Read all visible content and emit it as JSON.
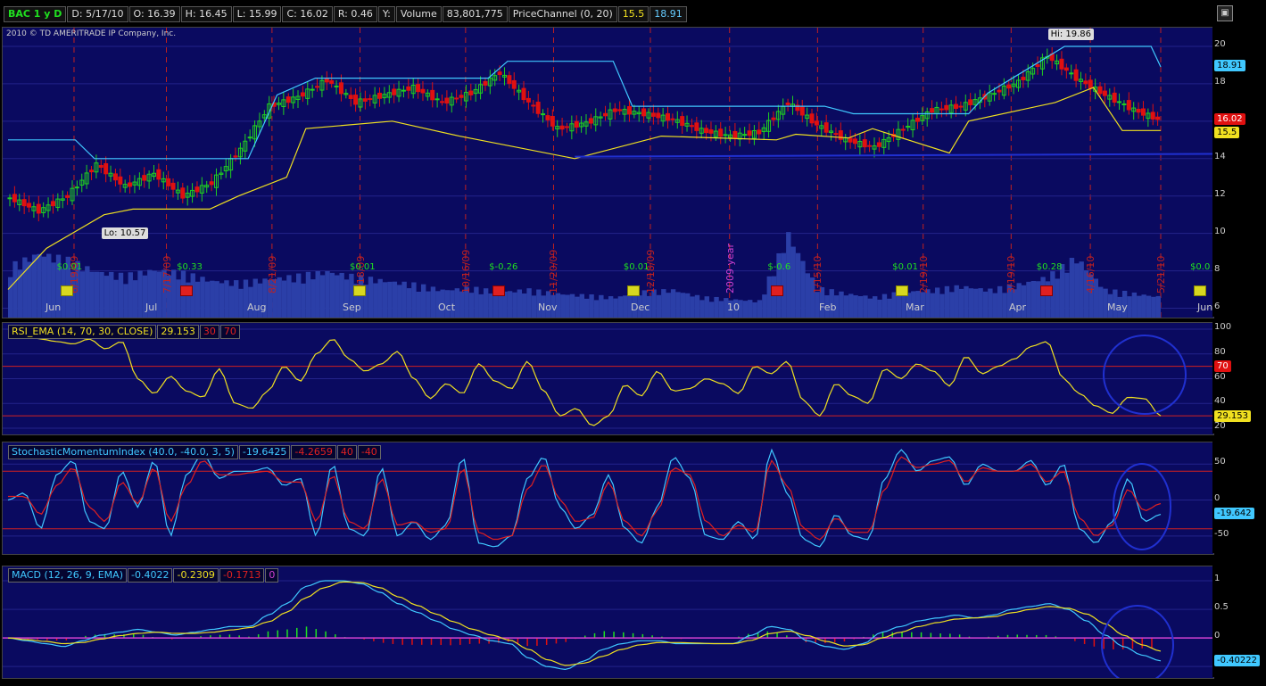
{
  "header": {
    "symbol": "BAC 1 y D",
    "date": "D: 5/17/10",
    "open": "O: 16.39",
    "high": "H: 16.45",
    "low": "L: 15.99",
    "close": "C: 16.02",
    "range": "R: 0.46",
    "y": "Y:",
    "volume_label": "Volume",
    "volume_value": "83,801,775",
    "study_label": "PriceChannel (0, 20)",
    "study_low": "15.5",
    "study_high": "18.91",
    "copyright": "2010 © TD AMERITRADE IP Company, Inc."
  },
  "colors": {
    "pane_bg": "#0a0a60",
    "up_candle": "#20d020",
    "down_candle": "#e01010",
    "channel_upper": "#40c8ff",
    "channel_lower": "#f0e020",
    "rsi_line": "#f0e020",
    "smi_line": "#40c8ff",
    "smi_signal": "#e02020",
    "macd_line": "#40c8ff",
    "macd_signal": "#f0e020",
    "hist_pos": "#20e020",
    "hist_neg": "#e01010",
    "annotation": "#2030d0"
  },
  "chart_data": [
    {
      "type": "candlestick",
      "title": "BAC 1 y D",
      "x_months": [
        "Jun",
        "Jul",
        "Aug",
        "Sep",
        "Oct",
        "Nov",
        "Dec",
        "10",
        "Feb",
        "Mar",
        "Apr",
        "May",
        "Jun"
      ],
      "ylim": [
        5.5,
        21
      ],
      "yticks": [
        6,
        8,
        10,
        12,
        14,
        16,
        18,
        20
      ],
      "grid": true,
      "close_points": [
        [
          0,
          11.9
        ],
        [
          6,
          11.2
        ],
        [
          12,
          12.0
        ],
        [
          18,
          13.7
        ],
        [
          24,
          12.5
        ],
        [
          30,
          13.2
        ],
        [
          36,
          12.0
        ],
        [
          42,
          12.7
        ],
        [
          48,
          14.5
        ],
        [
          54,
          16.8
        ],
        [
          60,
          17.3
        ],
        [
          66,
          18.2
        ],
        [
          72,
          17.0
        ],
        [
          78,
          17.4
        ],
        [
          84,
          17.8
        ],
        [
          90,
          17.0
        ],
        [
          96,
          17.5
        ],
        [
          102,
          18.6
        ],
        [
          108,
          17.0
        ],
        [
          114,
          15.6
        ],
        [
          120,
          15.9
        ],
        [
          126,
          16.6
        ],
        [
          132,
          16.4
        ],
        [
          138,
          16.1
        ],
        [
          144,
          15.5
        ],
        [
          150,
          15.2
        ],
        [
          156,
          15.4
        ],
        [
          162,
          17.0
        ],
        [
          168,
          15.8
        ],
        [
          174,
          15.0
        ],
        [
          180,
          14.6
        ],
        [
          186,
          15.6
        ],
        [
          192,
          16.6
        ],
        [
          198,
          16.8
        ],
        [
          204,
          17.4
        ],
        [
          210,
          18.1
        ],
        [
          216,
          19.5
        ],
        [
          222,
          18.3
        ],
        [
          228,
          17.4
        ],
        [
          234,
          16.6
        ],
        [
          240,
          16.0
        ]
      ],
      "hi_label": "Hi: 19.86",
      "lo_label": "Lo: 10.57",
      "last_price_tag": "16.02",
      "price_channel": {
        "name": "PriceChannel (0, 20)",
        "upper": [
          [
            0,
            15.0
          ],
          [
            14,
            15.0
          ],
          [
            18,
            14.0
          ],
          [
            40,
            14.0
          ],
          [
            50,
            14.0
          ],
          [
            56,
            17.4
          ],
          [
            64,
            18.3
          ],
          [
            100,
            18.3
          ],
          [
            104,
            19.2
          ],
          [
            126,
            19.2
          ],
          [
            130,
            16.8
          ],
          [
            170,
            16.8
          ],
          [
            176,
            16.4
          ],
          [
            200,
            16.4
          ],
          [
            204,
            17.5
          ],
          [
            220,
            20.0
          ],
          [
            238,
            20.0
          ],
          [
            240,
            18.9
          ]
        ],
        "lower": [
          [
            0,
            7.0
          ],
          [
            8,
            9.2
          ],
          [
            20,
            11.0
          ],
          [
            26,
            11.3
          ],
          [
            42,
            11.3
          ],
          [
            48,
            12.0
          ],
          [
            58,
            13.0
          ],
          [
            62,
            15.6
          ],
          [
            80,
            16.0
          ],
          [
            94,
            15.2
          ],
          [
            118,
            14.0
          ],
          [
            136,
            15.2
          ],
          [
            160,
            15.0
          ],
          [
            164,
            15.3
          ],
          [
            175,
            15.1
          ],
          [
            180,
            15.6
          ],
          [
            196,
            14.3
          ],
          [
            200,
            16.0
          ],
          [
            218,
            17.0
          ],
          [
            226,
            17.8
          ],
          [
            232,
            15.5
          ],
          [
            240,
            15.5
          ]
        ],
        "upper_tag": "18.91",
        "lower_tag": "15.5"
      },
      "volume_bars_norm": [
        0.55,
        0.7,
        0.62,
        0.5,
        0.45,
        0.52,
        0.48,
        0.4,
        0.38,
        0.42,
        0.45,
        0.5,
        0.44,
        0.4,
        0.36,
        0.3,
        0.32,
        0.28,
        0.3,
        0.26,
        0.24,
        0.22,
        0.28,
        0.3,
        0.22,
        0.2,
        0.18,
        0.9,
        0.32,
        0.26,
        0.22,
        0.28,
        0.3,
        0.34,
        0.3,
        0.36,
        0.44,
        0.65,
        0.3,
        0.26,
        0.22
      ],
      "dates": [
        "6/19/09",
        "7/17/09",
        "8/21/09",
        "9/18/09",
        "10/16/09",
        "11/20/09",
        "12/18/09",
        "2009 year",
        "1/15/10",
        "2/19/10",
        "3/19/10",
        "4/16/10",
        "5/21/10"
      ],
      "events": [
        {
          "label": "$0.01",
          "x": 12,
          "icon": "dividend"
        },
        {
          "label": "$0.33",
          "x": 37,
          "icon": "earnings"
        },
        {
          "label": "$0.01",
          "x": 73,
          "icon": "dividend"
        },
        {
          "label": "$-0.26",
          "x": 102,
          "icon": "earnings"
        },
        {
          "label": "$0.01",
          "x": 130,
          "icon": "dividend"
        },
        {
          "label": "$-0.6",
          "x": 160,
          "icon": "earnings"
        },
        {
          "label": "$0.01",
          "x": 186,
          "icon": "dividend"
        },
        {
          "label": "$0.28",
          "x": 216,
          "icon": "earnings"
        },
        {
          "label": "$0.0",
          "x": 248,
          "icon": "dividend"
        }
      ]
    },
    {
      "type": "line",
      "title": "RSI_EMA (14, 70, 30, CLOSE)",
      "value_label": "29.153",
      "overbought_label": "70",
      "oversold_label": "30",
      "ylim": [
        15,
        105
      ],
      "yticks": [
        20,
        40,
        60,
        80,
        100
      ],
      "levels": [
        70,
        30
      ],
      "series": [
        {
          "name": "RSI",
          "values": [
            100,
            96,
            92,
            90,
            88,
            92,
            84,
            90,
            60,
            48,
            62,
            50,
            45,
            68,
            40,
            36,
            50,
            70,
            58,
            80,
            92,
            76,
            66,
            72,
            82,
            60,
            44,
            56,
            48,
            72,
            58,
            52,
            74,
            50,
            30,
            36,
            22,
            30,
            55,
            46,
            66,
            50,
            52,
            60,
            56,
            48,
            70,
            64,
            74,
            42,
            30,
            56,
            46,
            40,
            68,
            60,
            72,
            66,
            54,
            78,
            64,
            70,
            76,
            86,
            90,
            60,
            48,
            38,
            32,
            45,
            44,
            30
          ]
        }
      ]
    },
    {
      "type": "line",
      "title": "StochasticMomentumIndex (40.0, -40.0, 3, 5)",
      "value_label": "-19.6425",
      "avg_label": "-4.2659",
      "over_label": "40",
      "under_label": "-40",
      "ylim": [
        -75,
        80
      ],
      "yticks": [
        50,
        0,
        -50
      ],
      "levels": [
        40,
        -40
      ],
      "series": [
        {
          "name": "SMI",
          "values": [
            0,
            10,
            -40,
            35,
            55,
            -30,
            -40,
            40,
            -10,
            55,
            -50,
            35,
            65,
            30,
            40,
            40,
            45,
            20,
            30,
            -50,
            50,
            -40,
            -50,
            45,
            -50,
            -30,
            -55,
            -35,
            60,
            -60,
            -65,
            -50,
            30,
            60,
            -10,
            -40,
            -20,
            35,
            -40,
            -60,
            -10,
            60,
            30,
            -50,
            -55,
            -30,
            -55,
            70,
            10,
            -55,
            -65,
            -20,
            -50,
            -55,
            30,
            70,
            40,
            55,
            60,
            20,
            50,
            40,
            40,
            55,
            20,
            50,
            -40,
            -60,
            -30,
            30,
            -30,
            -20
          ]
        },
        {
          "name": "Avg",
          "values": [
            5,
            5,
            -20,
            20,
            45,
            -10,
            -30,
            25,
            -5,
            45,
            -30,
            20,
            55,
            35,
            35,
            38,
            40,
            25,
            25,
            -30,
            35,
            -30,
            -40,
            30,
            -35,
            -30,
            -45,
            -40,
            45,
            -45,
            -55,
            -50,
            15,
            50,
            0,
            -30,
            -25,
            25,
            -30,
            -50,
            -15,
            45,
            35,
            -30,
            -50,
            -35,
            -45,
            55,
            20,
            -40,
            -55,
            -25,
            -45,
            -45,
            15,
            60,
            45,
            50,
            55,
            25,
            45,
            40,
            40,
            50,
            25,
            40,
            -25,
            -50,
            -35,
            15,
            -15,
            -5
          ]
        }
      ],
      "value_tag": "-19.642"
    },
    {
      "type": "line",
      "title": "MACD (12, 26, 9, EMA)",
      "value_label": "-0.4022",
      "avg_label": "-0.2309",
      "diff_label": "-0.1713",
      "zero_label": "0",
      "ylim": [
        -0.7,
        1.25
      ],
      "yticks": [
        1,
        0.5,
        0,
        -0.5
      ],
      "levels": [
        0
      ],
      "series": [
        {
          "name": "MACD",
          "values": [
            0,
            -0.05,
            -0.1,
            -0.15,
            -0.05,
            0.05,
            0.1,
            0.15,
            0.1,
            0.05,
            0.1,
            0.15,
            0.2,
            0.2,
            0.4,
            0.6,
            0.9,
            1.0,
            1.0,
            0.95,
            0.8,
            0.6,
            0.45,
            0.3,
            0.15,
            0.05,
            -0.05,
            -0.1,
            -0.35,
            -0.5,
            -0.55,
            -0.4,
            -0.2,
            -0.1,
            -0.05,
            -0.05,
            -0.1,
            -0.1,
            -0.1,
            -0.1,
            0.05,
            0.2,
            0.15,
            -0.05,
            -0.15,
            -0.2,
            -0.1,
            0.1,
            0.2,
            0.3,
            0.35,
            0.4,
            0.35,
            0.4,
            0.5,
            0.55,
            0.6,
            0.5,
            0.3,
            0.05,
            -0.15,
            -0.3,
            -0.4
          ]
        },
        {
          "name": "Avg",
          "values": [
            0,
            -0.03,
            -0.06,
            -0.1,
            -0.08,
            -0.02,
            0.04,
            0.08,
            0.1,
            0.08,
            0.08,
            0.1,
            0.14,
            0.18,
            0.28,
            0.45,
            0.7,
            0.88,
            0.98,
            0.97,
            0.88,
            0.72,
            0.57,
            0.42,
            0.28,
            0.15,
            0.05,
            -0.04,
            -0.2,
            -0.38,
            -0.48,
            -0.44,
            -0.32,
            -0.2,
            -0.12,
            -0.08,
            -0.08,
            -0.09,
            -0.1,
            -0.1,
            -0.04,
            0.08,
            0.12,
            0.04,
            -0.06,
            -0.14,
            -0.12,
            0.0,
            0.1,
            0.2,
            0.27,
            0.33,
            0.35,
            0.37,
            0.44,
            0.5,
            0.55,
            0.52,
            0.42,
            0.25,
            0.05,
            -0.12,
            -0.23
          ]
        }
      ],
      "hist": [
        0,
        -0.02,
        -0.04,
        -0.05,
        0.03,
        0.07,
        0.06,
        0.07,
        0.0,
        -0.03,
        0.02,
        0.05,
        0.06,
        0.02,
        0.12,
        0.15,
        0.2,
        0.12,
        0.02,
        -0.02,
        -0.08,
        -0.12,
        -0.12,
        -0.12,
        -0.13,
        -0.1,
        -0.1,
        -0.06,
        -0.15,
        -0.12,
        -0.07,
        0.04,
        0.12,
        0.1,
        0.07,
        0.03,
        -0.02,
        -0.01,
        0.0,
        0.0,
        0.09,
        0.12,
        0.03,
        -0.09,
        -0.09,
        -0.06,
        0.02,
        0.1,
        0.1,
        0.1,
        0.08,
        0.07,
        0.0,
        0.03,
        0.06,
        0.05,
        0.05,
        -0.02,
        -0.12,
        -0.2,
        -0.2,
        -0.18,
        -0.17
      ],
      "value_tag": "-0.40222"
    }
  ]
}
